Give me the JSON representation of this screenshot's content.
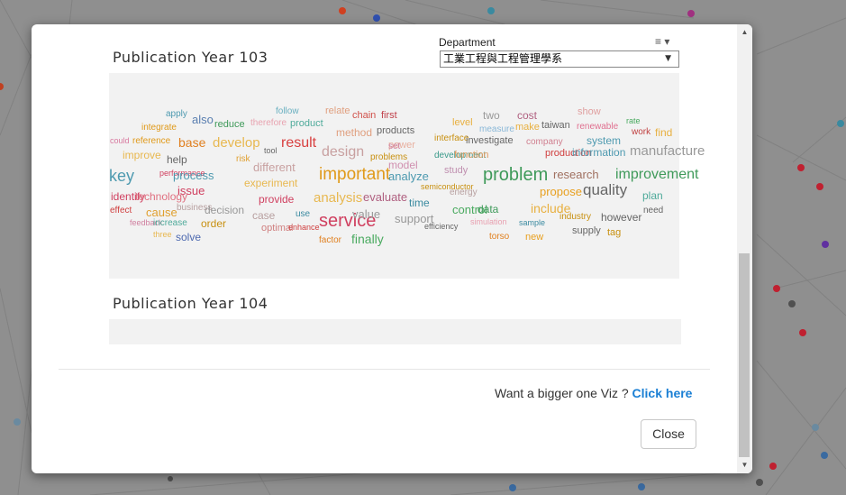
{
  "modal": {
    "sections": [
      {
        "title": "Publication Year 103"
      },
      {
        "title": "Publication Year 104"
      }
    ],
    "department": {
      "label": "Department",
      "menu_icon": "≡",
      "selected": "工業工程與工程管理學系",
      "menu_icon_name": "hamburger-menu-icon"
    },
    "wordcloud": [
      {
        "text": "apply",
        "c": "#4e9ab0"
      },
      {
        "text": "also",
        "c": "#5a7fb0"
      },
      {
        "text": "integrate",
        "c": "#e09a1a"
      },
      {
        "text": "reduce",
        "c": "#3f9a5a"
      },
      {
        "text": "therefore",
        "c": "#e8a3b0"
      },
      {
        "text": "product",
        "c": "#4eaa9a"
      },
      {
        "text": "follow",
        "c": "#6ab0c0"
      },
      {
        "text": "relate",
        "c": "#e0a080"
      },
      {
        "text": "chain",
        "c": "#d0504a"
      },
      {
        "text": "first",
        "c": "#c0404a"
      },
      {
        "text": "level",
        "c": "#e8b040"
      },
      {
        "text": "two",
        "c": "#999999"
      },
      {
        "text": "cost",
        "c": "#b06080"
      },
      {
        "text": "show",
        "c": "#e0a0a0"
      },
      {
        "text": "rate",
        "c": "#4aaa60"
      },
      {
        "text": "could",
        "c": "#d87aa0"
      },
      {
        "text": "reference",
        "c": "#e09a1a"
      },
      {
        "text": "base",
        "c": "#e08020"
      },
      {
        "text": "develop",
        "c": "#e8b850"
      },
      {
        "text": "result",
        "c": "#d84040"
      },
      {
        "text": "method",
        "c": "#e0a080"
      },
      {
        "text": "products",
        "c": "#666666"
      },
      {
        "text": "measure",
        "c": "#8ab8d8"
      },
      {
        "text": "make",
        "c": "#e8b040"
      },
      {
        "text": "taiwan",
        "c": "#666666"
      },
      {
        "text": "renewable",
        "c": "#e07090"
      },
      {
        "text": "work",
        "c": "#c04040"
      },
      {
        "text": "find",
        "c": "#e8b040"
      },
      {
        "text": "improve",
        "c": "#e8b850"
      },
      {
        "text": "tool",
        "c": "#666666"
      },
      {
        "text": "design",
        "c": "#c8a0a0"
      },
      {
        "text": "power",
        "c": "#e8b0a0"
      },
      {
        "text": "interface",
        "c": "#c89010"
      },
      {
        "text": "investigate",
        "c": "#666666"
      },
      {
        "text": "company",
        "c": "#d08090"
      },
      {
        "text": "system",
        "c": "#4e9ab0"
      },
      {
        "text": "manufacture",
        "c": "#999999"
      },
      {
        "text": "help",
        "c": "#666666"
      },
      {
        "text": "risk",
        "c": "#e0a030"
      },
      {
        "text": "problems",
        "c": "#c89010"
      },
      {
        "text": "set",
        "c": "#d080a0"
      },
      {
        "text": "development",
        "c": "#3a9a8a"
      },
      {
        "text": "function",
        "c": "#e09a60"
      },
      {
        "text": "production",
        "c": "#d04040"
      },
      {
        "text": "information",
        "c": "#4e9ab0"
      },
      {
        "text": "different",
        "c": "#c8a0a0"
      },
      {
        "text": "model",
        "c": "#d090b0"
      },
      {
        "text": "key",
        "c": "#4e9ab0"
      },
      {
        "text": "performance",
        "c": "#d04060"
      },
      {
        "text": "process",
        "c": "#4e9ab0"
      },
      {
        "text": "important",
        "c": "#e09a1a"
      },
      {
        "text": "analyze",
        "c": "#4e9ab0"
      },
      {
        "text": "study",
        "c": "#c090b0"
      },
      {
        "text": "problem",
        "c": "#3f9a5a"
      },
      {
        "text": "research",
        "c": "#a07060"
      },
      {
        "text": "improvement",
        "c": "#3f9a5a"
      },
      {
        "text": "experiment",
        "c": "#e8b850"
      },
      {
        "text": "issue",
        "c": "#d04060"
      },
      {
        "text": "semiconductor",
        "c": "#c89010"
      },
      {
        "text": "energy",
        "c": "#b8a0a0"
      },
      {
        "text": "propose",
        "c": "#e8a020"
      },
      {
        "text": "quality",
        "c": "#666666"
      },
      {
        "text": "plan",
        "c": "#4eaa9a"
      },
      {
        "text": "identify",
        "c": "#d04060"
      },
      {
        "text": "technology",
        "c": "#e07080"
      },
      {
        "text": "provide",
        "c": "#d04060"
      },
      {
        "text": "analysis",
        "c": "#e8b850"
      },
      {
        "text": "evaluate",
        "c": "#b06080"
      },
      {
        "text": "time",
        "c": "#3a8aa0"
      },
      {
        "text": "control",
        "c": "#4aaa60"
      },
      {
        "text": "data",
        "c": "#3f9a5a"
      },
      {
        "text": "include",
        "c": "#e8b040"
      },
      {
        "text": "effect",
        "c": "#d04040"
      },
      {
        "text": "cause",
        "c": "#e0a030"
      },
      {
        "text": "business",
        "c": "#b8a0a0"
      },
      {
        "text": "decision",
        "c": "#999999"
      },
      {
        "text": "case",
        "c": "#b8a0a0"
      },
      {
        "text": "use",
        "c": "#3a8aa0"
      },
      {
        "text": "service",
        "c": "#d04060"
      },
      {
        "text": "value",
        "c": "#999999"
      },
      {
        "text": "support",
        "c": "#999999"
      },
      {
        "text": "simulation",
        "c": "#e8a0b0"
      },
      {
        "text": "industry",
        "c": "#c89010"
      },
      {
        "text": "however",
        "c": "#666666"
      },
      {
        "text": "need",
        "c": "#666666"
      },
      {
        "text": "feedback",
        "c": "#d080a0"
      },
      {
        "text": "increase",
        "c": "#4eaa9a"
      },
      {
        "text": "order",
        "c": "#c89010"
      },
      {
        "text": "optimal",
        "c": "#d08080"
      },
      {
        "text": "enhance",
        "c": "#d04040"
      },
      {
        "text": "efficiency",
        "c": "#666666"
      },
      {
        "text": "sample",
        "c": "#3a8aa0"
      },
      {
        "text": "supply",
        "c": "#666666"
      },
      {
        "text": "tag",
        "c": "#c89010"
      },
      {
        "text": "three",
        "c": "#e8b850"
      },
      {
        "text": "solve",
        "c": "#4e6ab0"
      },
      {
        "text": "factor",
        "c": "#e08020"
      },
      {
        "text": "finally",
        "c": "#4aaa60"
      },
      {
        "text": "torso",
        "c": "#e08020"
      },
      {
        "text": "new",
        "c": "#e8a020"
      }
    ],
    "bigger_prompt": "Want a bigger one Viz ?",
    "bigger_link": "Click here",
    "close_label": "Close"
  }
}
